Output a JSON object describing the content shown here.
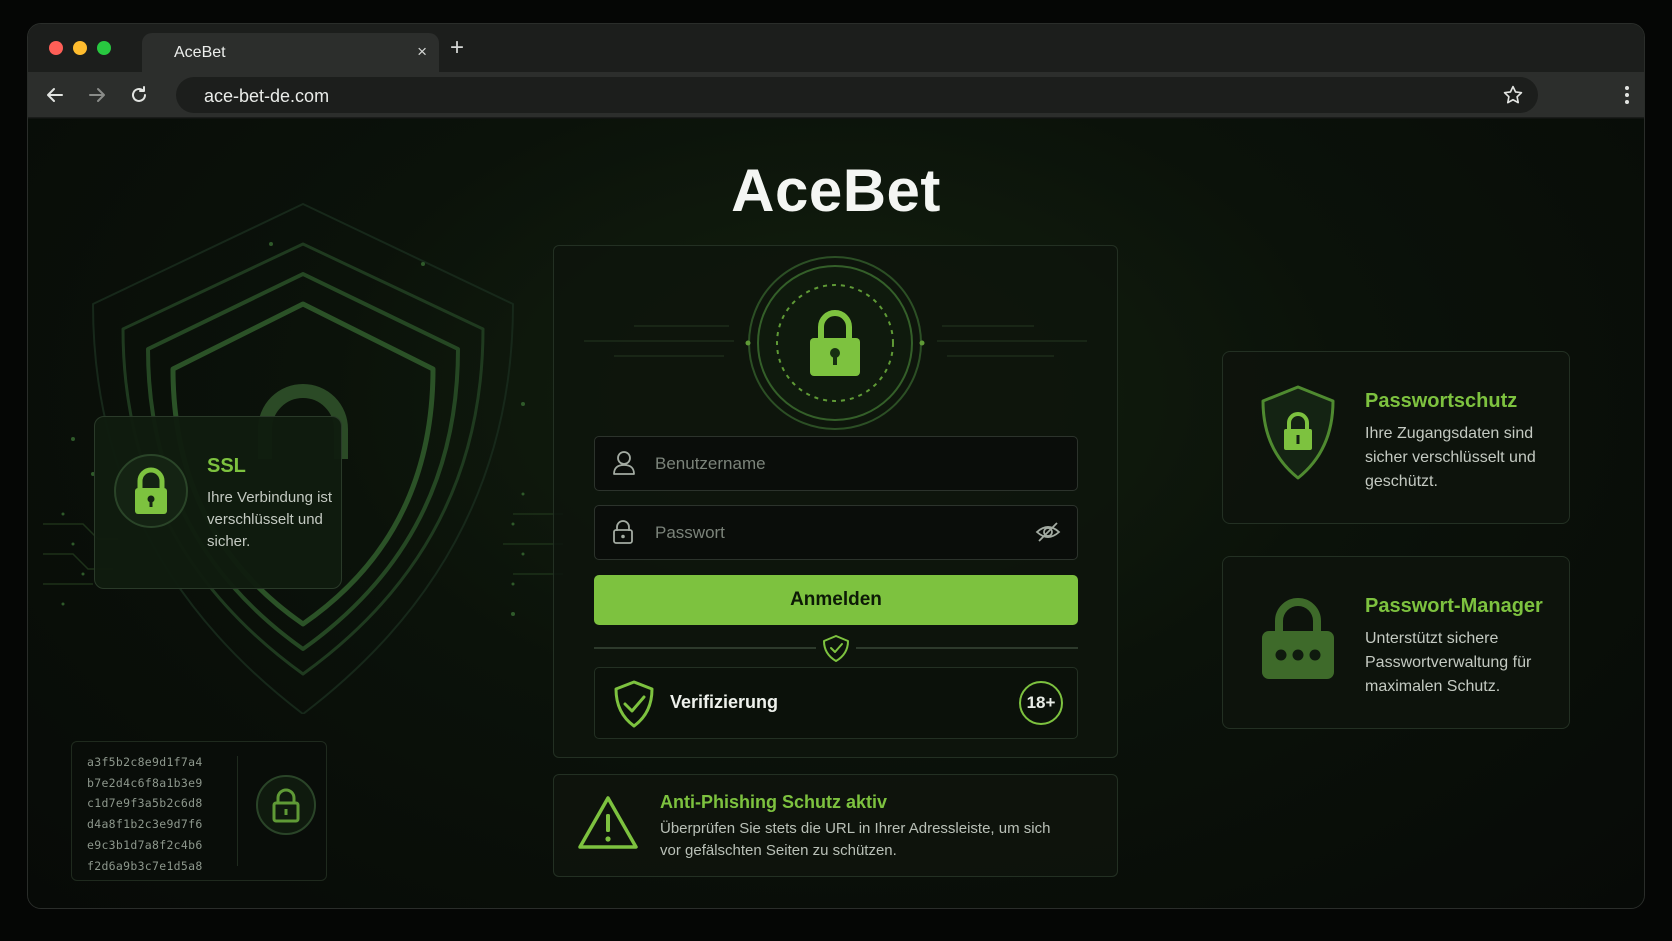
{
  "browser": {
    "tab_title": "AceBet",
    "tab_close": "×",
    "new_tab": "+",
    "url": "ace-bet-de.com"
  },
  "site": {
    "title": "AceBet"
  },
  "login": {
    "username_placeholder": "Benutzername",
    "password_placeholder": "Passwort",
    "submit_label": "Anmelden",
    "verification_label": "Verifizierung",
    "age_badge": "18+"
  },
  "phishing_notice": {
    "title": "Anti-Phishing Schutz aktiv",
    "text": "Überprüfen Sie stets die URL in Ihrer Adressleiste, um sich vor gefälschten Seiten zu schützen."
  },
  "feature_cards": [
    {
      "title": "Passwortschutz",
      "text": "Ihre Zugangsdaten sind sicher verschlüsselt und geschützt.",
      "icon": "shield-lock-icon"
    },
    {
      "title": "Passwort-Manager",
      "text": "Unterstützt sichere Passwortverwaltung für maximalen Schutz.",
      "icon": "padlock-dots-icon"
    }
  ],
  "ssl_card": {
    "title": "SSL",
    "text": "Ihre Verbindung ist verschlüsselt und sicher."
  },
  "hashes": [
    "a3f5b2c8e9d1f7a4",
    "b7e2d4c6f8a1b3e9",
    "c1d7e9f3a5b2c6d8",
    "d4a8f1b2c3e9d7f6",
    "e9c3b1d7a8f2c4b6",
    "f2d6a9b3c7e1d5a8"
  ],
  "colors": {
    "accent": "#7dc23f",
    "background": "#0b120a",
    "card_border": "#233023"
  }
}
